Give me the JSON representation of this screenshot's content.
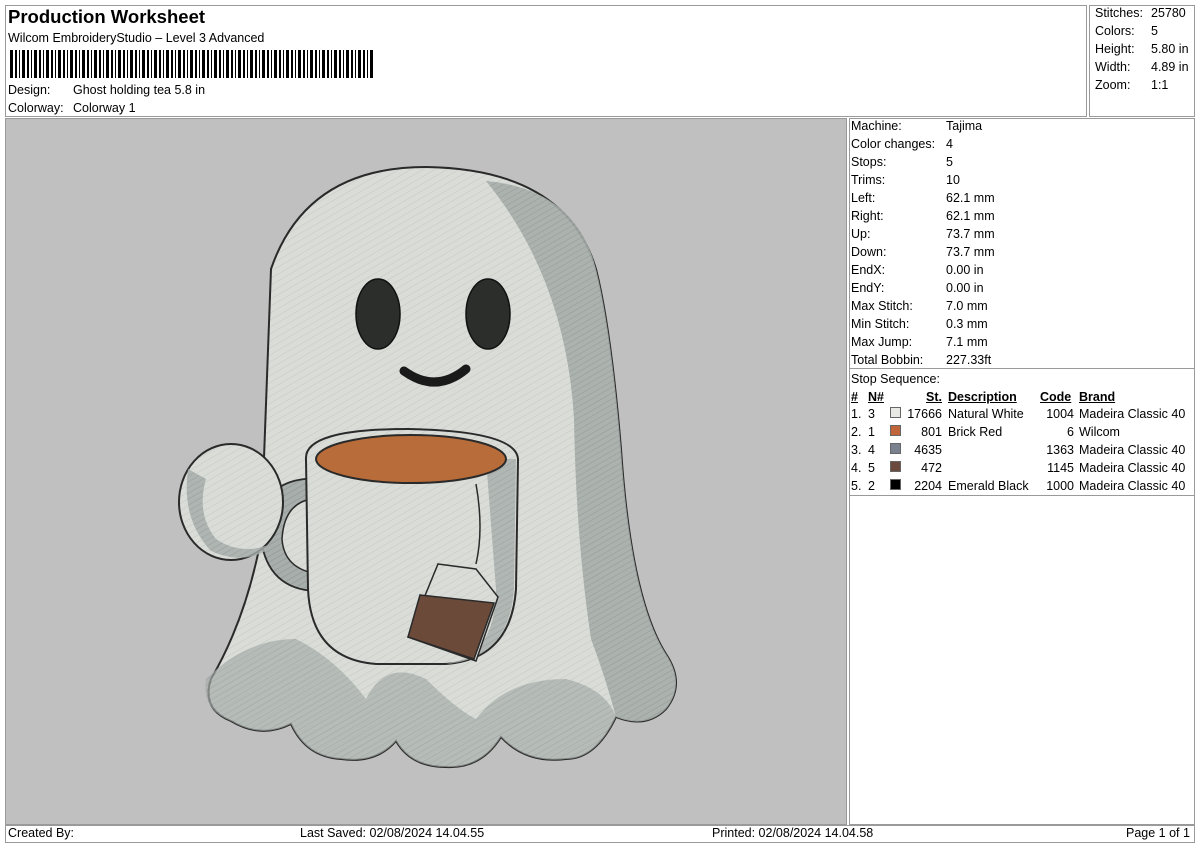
{
  "header": {
    "title": "Production Worksheet",
    "subtitle": "Wilcom EmbroideryStudio – Level 3 Advanced",
    "design_label": "Design:",
    "design_value": "Ghost holding tea 5.8 in",
    "colorway_label": "Colorway:",
    "colorway_value": "Colorway 1"
  },
  "summary": [
    {
      "label": "Stitches:",
      "value": "25780"
    },
    {
      "label": "Colors:",
      "value": "5"
    },
    {
      "label": "Height:",
      "value": "5.80 in"
    },
    {
      "label": "Width:",
      "value": "4.89 in"
    },
    {
      "label": "Zoom:",
      "value": "1:1"
    }
  ],
  "machine_info": [
    {
      "label": "Machine:",
      "value": "Tajima"
    },
    {
      "label": "Color changes:",
      "value": "4"
    },
    {
      "label": "Stops:",
      "value": "5"
    },
    {
      "label": "Trims:",
      "value": "10"
    },
    {
      "label": "Left:",
      "value": "62.1 mm"
    },
    {
      "label": "Right:",
      "value": "62.1 mm"
    },
    {
      "label": "Up:",
      "value": "73.7 mm"
    },
    {
      "label": "Down:",
      "value": "73.7 mm"
    },
    {
      "label": "EndX:",
      "value": "0.00 in"
    },
    {
      "label": "EndY:",
      "value": "0.00 in"
    },
    {
      "label": "Max Stitch:",
      "value": "7.0 mm"
    },
    {
      "label": "Min Stitch:",
      "value": "0.3 mm"
    },
    {
      "label": "Max Jump:",
      "value": "7.1 mm"
    },
    {
      "label": "Total Bobbin:",
      "value": "227.33ft"
    }
  ],
  "stop_sequence": {
    "title": "Stop Sequence:",
    "headers": {
      "num": "#",
      "n": "N#",
      "st": "St.",
      "description": "Description",
      "code": "Code",
      "brand": "Brand"
    },
    "rows": [
      {
        "num": "1.",
        "n": "3",
        "color": "#e8e8e4",
        "st": "17666",
        "description": "Natural White",
        "code": "1004",
        "brand": "Madeira Classic 40"
      },
      {
        "num": "2.",
        "n": "1",
        "color": "#c0643a",
        "st": "801",
        "description": "Brick Red",
        "code": "6",
        "brand": "Wilcom"
      },
      {
        "num": "3.",
        "n": "4",
        "color": "#7a8290",
        "st": "4635",
        "description": "",
        "code": "1363",
        "brand": "Madeira Classic 40"
      },
      {
        "num": "4.",
        "n": "5",
        "color": "#6a4a3c",
        "st": "472",
        "description": "",
        "code": "1145",
        "brand": "Madeira Classic 40"
      },
      {
        "num": "5.",
        "n": "2",
        "color": "#000000",
        "st": "2204",
        "description": "Emerald Black",
        "code": "1000",
        "brand": "Madeira Classic 40"
      }
    ]
  },
  "footer": {
    "created_by": "Created By:",
    "last_saved": "Last Saved: 02/08/2024 14.04.55",
    "printed": "Printed: 02/08/2024 14.04.58",
    "page": "Page 1 of 1"
  }
}
